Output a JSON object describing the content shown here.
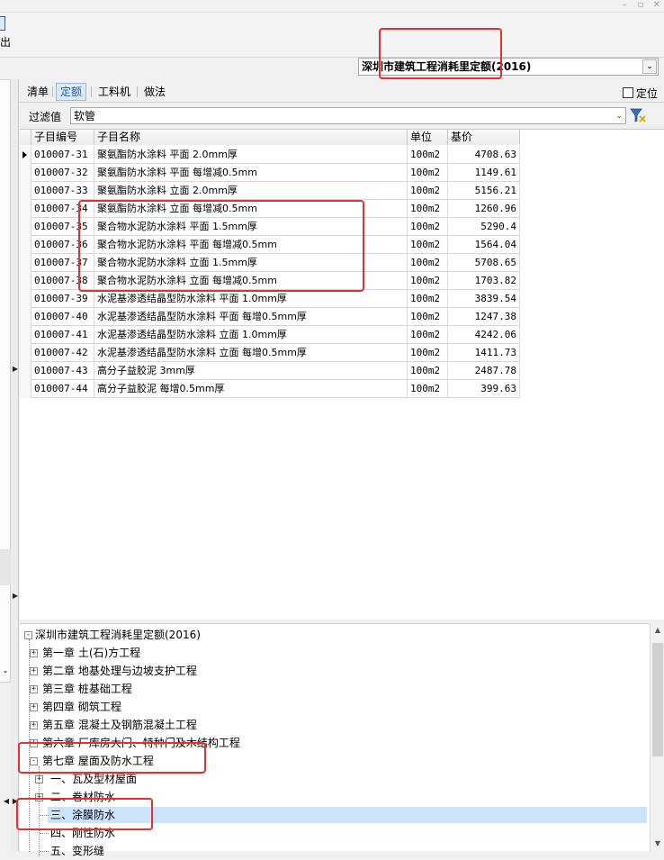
{
  "toolbar": {
    "export_label": "出"
  },
  "library_select": {
    "value": "深圳市建筑工程消耗里定额(2016)"
  },
  "tabs": [
    {
      "label": "清单"
    },
    {
      "label": "定额"
    },
    {
      "label": "工料机"
    },
    {
      "label": "做法"
    }
  ],
  "locate": {
    "label": "定位"
  },
  "filter": {
    "label": "过滤值",
    "value": "软管"
  },
  "grid": {
    "headers": [
      "子目编号",
      "子目名称",
      "单位",
      "基价"
    ],
    "rows": [
      {
        "code": "010007-31",
        "name": "聚氨酯防水涂料 平面 2.0mm厚",
        "unit": "100m2",
        "price": "4708.63"
      },
      {
        "code": "010007-32",
        "name": "聚氨酯防水涂料 平面 每增减0.5mm",
        "unit": "100m2",
        "price": "1149.61"
      },
      {
        "code": "010007-33",
        "name": "聚氨酯防水涂料 立面 2.0mm厚",
        "unit": "100m2",
        "price": "5156.21"
      },
      {
        "code": "010007-34",
        "name": "聚氨酯防水涂料 立面 每增减0.5mm",
        "unit": "100m2",
        "price": "1260.96"
      },
      {
        "code": "010007-35",
        "name": "聚合物水泥防水涂料 平面 1.5mm厚",
        "unit": "100m2",
        "price": "5290.4"
      },
      {
        "code": "010007-36",
        "name": "聚合物水泥防水涂料 平面 每增减0.5mm",
        "unit": "100m2",
        "price": "1564.04"
      },
      {
        "code": "010007-37",
        "name": "聚合物水泥防水涂料 立面 1.5mm厚",
        "unit": "100m2",
        "price": "5708.65"
      },
      {
        "code": "010007-38",
        "name": "聚合物水泥防水涂料 立面 每增减0.5mm",
        "unit": "100m2",
        "price": "1703.82"
      },
      {
        "code": "010007-39",
        "name": "水泥基渗透结晶型防水涂料 平面 1.0mm厚",
        "unit": "100m2",
        "price": "3839.54"
      },
      {
        "code": "010007-40",
        "name": "水泥基渗透结晶型防水涂料 平面 每增0.5mm厚",
        "unit": "100m2",
        "price": "1247.38"
      },
      {
        "code": "010007-41",
        "name": "水泥基渗透结晶型防水涂料 立面 1.0mm厚",
        "unit": "100m2",
        "price": "4242.06"
      },
      {
        "code": "010007-42",
        "name": "水泥基渗透结晶型防水涂料 立面 每增0.5mm厚",
        "unit": "100m2",
        "price": "1411.73"
      },
      {
        "code": "010007-43",
        "name": "高分子益胶泥 3mm厚",
        "unit": "100m2",
        "price": "2487.78"
      },
      {
        "code": "010007-44",
        "name": "高分子益胶泥 每增0.5mm厚",
        "unit": "100m2",
        "price": "399.63"
      }
    ]
  },
  "tree": {
    "root": "深圳市建筑工程消耗里定额(2016)",
    "chapters": [
      "第一章 土(石)方工程",
      "第二章 地基处理与边坡支护工程",
      "第三章 桩基础工程",
      "第四章 砌筑工程",
      "第五章 混凝土及钢筋混凝土工程",
      "第六章 厂库房大门、特种门及木结构工程",
      "第七章 屋面及防水工程"
    ],
    "sections": [
      "一、瓦及型材屋面",
      "二、卷材防水",
      "三、涂膜防水",
      "四、刚性防水",
      "五、变形缝"
    ]
  },
  "colors": {
    "highlight": "#e0322e",
    "selection": "#cce2fb",
    "active_tab": "#1a5fb4"
  }
}
